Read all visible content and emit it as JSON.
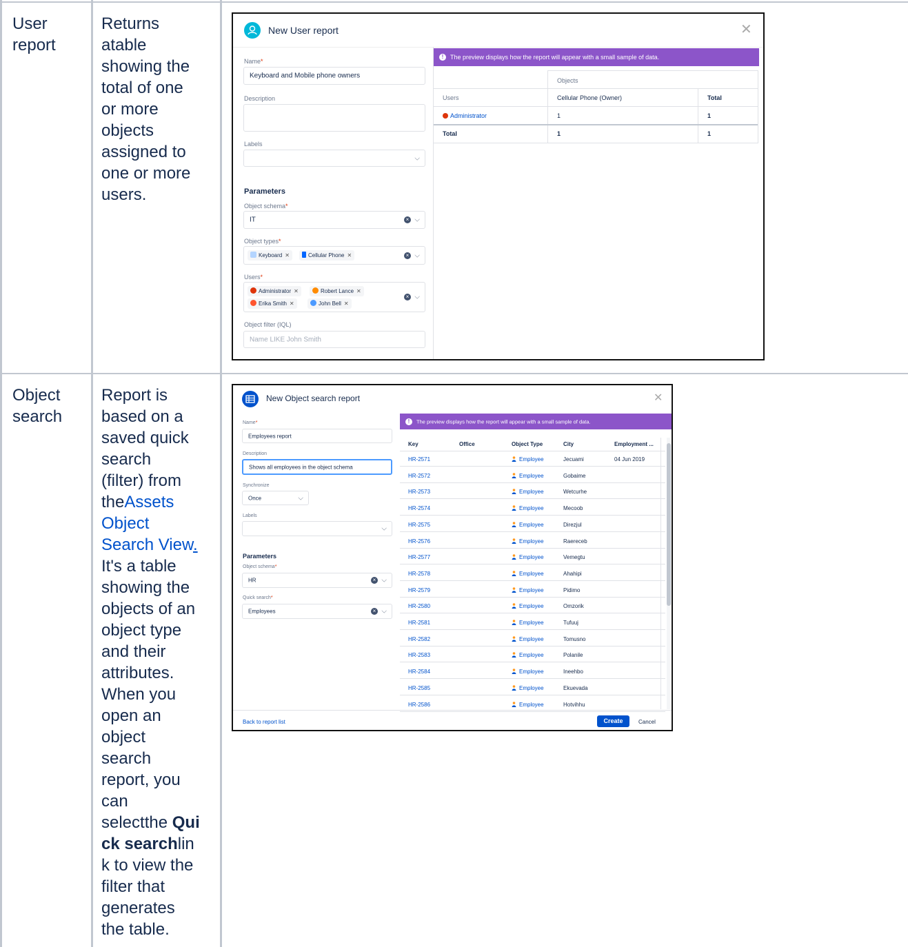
{
  "rows": [
    {
      "type": "User report",
      "type_lines": [
        "User",
        "report"
      ],
      "description_lines": [
        "Returns",
        "atable",
        "showing the",
        "total of one",
        "or more",
        "objects",
        "assigned to",
        "one or more",
        "users."
      ]
    },
    {
      "type": "Object search",
      "type_lines": [
        "Object",
        "search"
      ],
      "desc_lines_before": [
        "Report is",
        "based on a",
        "saved quick",
        "search",
        "(filter) from",
        "the"
      ],
      "link_lines": [
        "Assets",
        "Object",
        "Search View"
      ],
      "link_suffix": ".",
      "desc_lines_after": [
        "It's a table",
        "showing the",
        "objects of an",
        "object type",
        "and their",
        "attributes.",
        "When you",
        "open an",
        "object",
        "search",
        "report, you",
        "can"
      ],
      "select_prefix": "selectthe ",
      "bold_part1": "Qui",
      "bold_part2": "ck search",
      "after_bold": "lin",
      "desc_lines_end": [
        "k to view the",
        "filter that",
        "generates",
        "the table."
      ]
    }
  ],
  "dialog1": {
    "title": "New User report",
    "fields": {
      "name_label": "Name",
      "name_value": "Keyboard and Mobile phone owners",
      "description_label": "Description",
      "labels_label": "Labels",
      "parameters_heading": "Parameters",
      "schema_label": "Object schema",
      "schema_value": "IT",
      "types_label": "Object types",
      "types_tags": [
        "Keyboard",
        "Cellular Phone"
      ],
      "users_label": "Users",
      "users_tags_row1": [
        "Administrator",
        "Robert Lance"
      ],
      "users_tags_row2": [
        "Erika Smith",
        "John Bell"
      ],
      "filter_label": "Object filter (IQL)",
      "filter_placeholder": "Name LIKE John Smith"
    },
    "banner": "The preview displays how the report will appear with a small sample of data.",
    "preview": {
      "group_header": "Objects",
      "col_users": "Users",
      "col_phone": "Cellular Phone (Owner)",
      "col_total": "Total",
      "row_user": "Administrator",
      "row_value": "1",
      "row_total": "1",
      "total_label": "Total",
      "total_value": "1",
      "total_total": "1"
    }
  },
  "dialog2": {
    "title": "New Object search report",
    "fields": {
      "name_label": "Name",
      "name_value": "Employees report",
      "description_label": "Description",
      "description_value": "Shows all employees in the object schema",
      "sync_label": "Synchronize",
      "sync_value": "Once",
      "labels_label": "Labels",
      "parameters_heading": "Parameters",
      "schema_label": "Object schema",
      "schema_value": "HR",
      "quick_label": "Quick search",
      "quick_value": "Employees"
    },
    "banner": "The preview displays how the report will appear with a small sample of data.",
    "columns": [
      "Key",
      "Office",
      "Object Type",
      "City",
      "Employment ..."
    ],
    "rows": [
      {
        "key": "HR-2571",
        "type": "Employee",
        "city": "Jecuami",
        "emp": "04 Jun 2019"
      },
      {
        "key": "HR-2572",
        "type": "Employee",
        "city": "Gobaime",
        "emp": ""
      },
      {
        "key": "HR-2573",
        "type": "Employee",
        "city": "Wetcurhe",
        "emp": ""
      },
      {
        "key": "HR-2574",
        "type": "Employee",
        "city": "Mecoob",
        "emp": ""
      },
      {
        "key": "HR-2575",
        "type": "Employee",
        "city": "Direzjul",
        "emp": ""
      },
      {
        "key": "HR-2576",
        "type": "Employee",
        "city": "Raereceb",
        "emp": ""
      },
      {
        "key": "HR-2577",
        "type": "Employee",
        "city": "Vemegtu",
        "emp": ""
      },
      {
        "key": "HR-2578",
        "type": "Employee",
        "city": "Ahahipi",
        "emp": ""
      },
      {
        "key": "HR-2579",
        "type": "Employee",
        "city": "Pidimo",
        "emp": ""
      },
      {
        "key": "HR-2580",
        "type": "Employee",
        "city": "Omzorik",
        "emp": ""
      },
      {
        "key": "HR-2581",
        "type": "Employee",
        "city": "Tufuuj",
        "emp": ""
      },
      {
        "key": "HR-2582",
        "type": "Employee",
        "city": "Tomusno",
        "emp": ""
      },
      {
        "key": "HR-2583",
        "type": "Employee",
        "city": "Polanile",
        "emp": ""
      },
      {
        "key": "HR-2584",
        "type": "Employee",
        "city": "Ineehbo",
        "emp": ""
      },
      {
        "key": "HR-2585",
        "type": "Employee",
        "city": "Ekuevada",
        "emp": ""
      },
      {
        "key": "HR-2586",
        "type": "Employee",
        "city": "Hotvihhu",
        "emp": ""
      }
    ],
    "back_link": "Back to report list",
    "create_button": "Create",
    "cancel_button": "Cancel"
  },
  "colors": {
    "accent": "#0052cc",
    "banner": "#8c55c9",
    "border": "#c1c7d0",
    "required": "#de350b"
  }
}
